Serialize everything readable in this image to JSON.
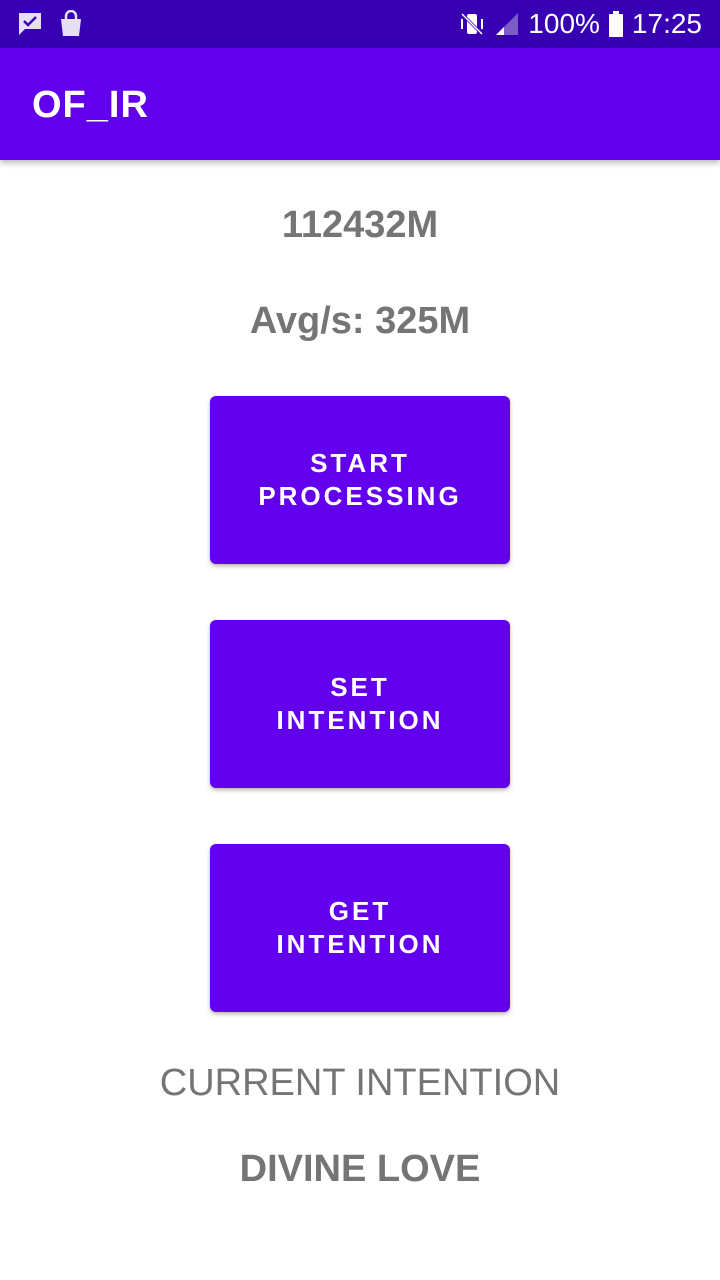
{
  "status_bar": {
    "left_icons": [
      "message-icon",
      "shopping-bag-icon"
    ],
    "right_icons": [
      "vibrate-icon",
      "signal-icon",
      "battery-icon"
    ],
    "battery_text": "100%",
    "time": "17:25",
    "background_color": "#3700B3"
  },
  "app_bar": {
    "title": "OF_IR",
    "color": "#6200EE"
  },
  "stats": {
    "total": "112432M",
    "average": "Avg/s: 325M"
  },
  "buttons": {
    "start": {
      "line1": "START",
      "line2": "PROCESSING"
    },
    "set": {
      "line1": "SET",
      "line2": "INTENTION"
    },
    "get": {
      "line1": "GET",
      "line2": "INTENTION"
    }
  },
  "intention": {
    "heading": "CURRENT INTENTION",
    "value": "DIVINE LOVE"
  }
}
